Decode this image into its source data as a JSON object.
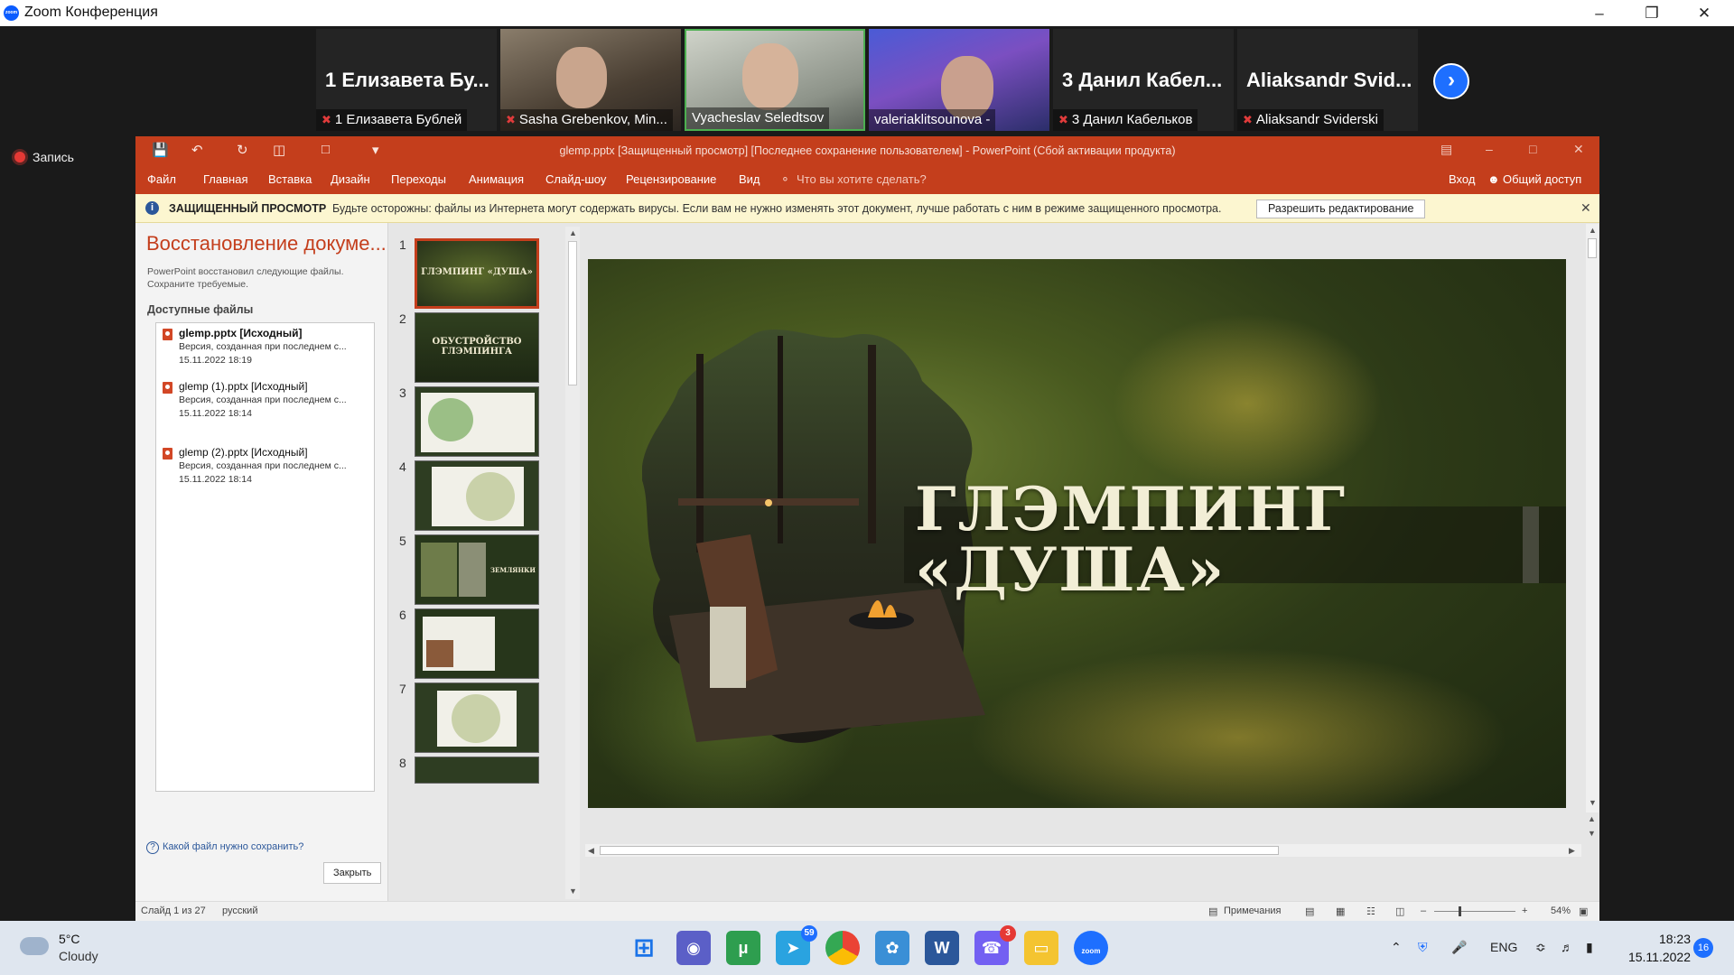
{
  "zoom": {
    "title": "Zoom Конференция",
    "record": "Запись"
  },
  "participants": [
    {
      "big": "1 Елизавета Бу...",
      "label": "1 Елизавета Бублей",
      "muted": true
    },
    {
      "big": "",
      "label": "Sasha Grebenkov, Min...",
      "muted": true
    },
    {
      "big": "",
      "label": "Vyacheslav Seledtsov",
      "muted": false
    },
    {
      "big": "",
      "label": "valeriaklitsounova -",
      "muted": false
    },
    {
      "big": "3 Данил Кабел...",
      "label": "3 Данил Кабельков",
      "muted": true
    },
    {
      "big": "Aliaksandr Svid...",
      "label": "Aliaksandr Sviderski",
      "muted": true
    }
  ],
  "ppt": {
    "title": "glemp.pptx [Защищенный просмотр] [Последнее сохранение пользователем] - PowerPoint (Сбой активации продукта)",
    "tabs": [
      "Файл",
      "Главная",
      "Вставка",
      "Дизайн",
      "Переходы",
      "Анимация",
      "Слайд-шоу",
      "Рецензирование",
      "Вид"
    ],
    "tell_me": "Что вы хотите сделать?",
    "signin": "Вход",
    "share": "Общий доступ",
    "protected": {
      "bold": "ЗАЩИЩЕННЫЙ ПРОСМОТР",
      "message": "Будьте осторожны: файлы из Интернета могут содержать вирусы. Если вам не нужно изменять этот документ, лучше работать с ним в режиме защищенного просмотра.",
      "button": "Разрешить редактирование"
    },
    "recovery": {
      "heading": "Восстановление докуме...",
      "sub": "PowerPoint восстановил следующие файлы. Сохраните требуемые.",
      "available": "Доступные файлы",
      "files": [
        {
          "name": "glemp.pptx  [Исходный]",
          "desc": "Версия, созданная при последнем с...",
          "date": "15.11.2022 18:19"
        },
        {
          "name": "glemp (1).pptx  [Исходный]",
          "desc": "Версия, созданная при последнем с...",
          "date": "15.11.2022 18:14"
        },
        {
          "name": "glemp (2).pptx  [Исходный]",
          "desc": "Версия, созданная при последнем с...",
          "date": "15.11.2022 18:14"
        }
      ],
      "question": "Какой файл нужно сохранить?",
      "close": "Закрыть"
    },
    "thumbs": [
      {
        "n": "1",
        "text": "ГЛЭМПИНГ «ДУША»"
      },
      {
        "n": "2",
        "text": "ОБУСТРОЙСТВО ГЛЭМПИНГА"
      },
      {
        "n": "3",
        "text": ""
      },
      {
        "n": "4",
        "text": ""
      },
      {
        "n": "5",
        "text": "ЗЕМЛЯНКИ"
      },
      {
        "n": "6",
        "text": ""
      },
      {
        "n": "7",
        "text": ""
      },
      {
        "n": "8",
        "text": ""
      }
    ],
    "slide_title_1": "ГЛЭМПИНГ",
    "slide_title_2": "«ДУША»",
    "status": {
      "slide": "Слайд 1 из 27",
      "lang": "русский",
      "notes": "Примечания",
      "zoom": "54%"
    }
  },
  "taskbar": {
    "temp": "5°C",
    "weather": "Cloudy",
    "lang": "ENG",
    "time": "18:23",
    "date": "15.11.2022",
    "notif": "16",
    "telegram_badge": "59",
    "viber_badge": "3"
  }
}
